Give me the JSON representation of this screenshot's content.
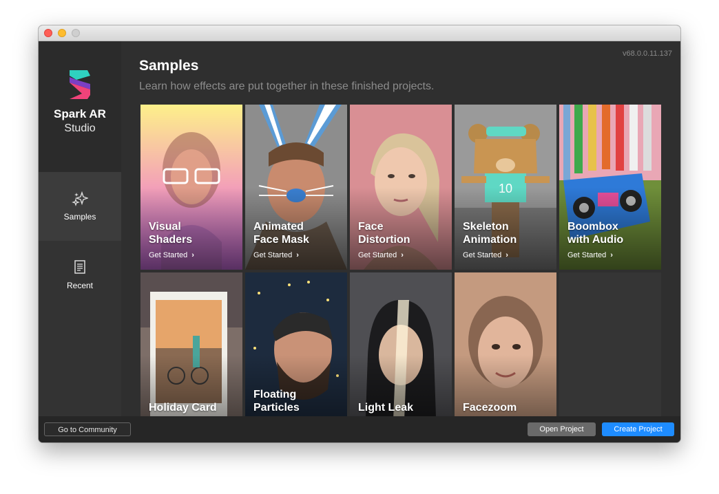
{
  "app": {
    "name": "Spark AR",
    "name_sub": "Studio",
    "version": "v68.0.0.11.137"
  },
  "sidebar": {
    "items": [
      {
        "label": "Samples",
        "icon": "sparkle-icon",
        "active": true
      },
      {
        "label": "Recent",
        "icon": "document-icon",
        "active": false
      }
    ]
  },
  "main": {
    "heading": "Samples",
    "subheading": "Learn how effects are put together in these finished projects."
  },
  "cards": [
    {
      "title_l1": "Visual",
      "title_l2": "Shaders",
      "cta": "Get Started"
    },
    {
      "title_l1": "Animated",
      "title_l2": "Face Mask",
      "cta": "Get Started"
    },
    {
      "title_l1": "Face",
      "title_l2": "Distortion",
      "cta": "Get Started"
    },
    {
      "title_l1": "Skeleton",
      "title_l2": "Animation",
      "cta": "Get Started"
    },
    {
      "title_l1": "Boombox",
      "title_l2": "with Audio",
      "cta": "Get Started"
    },
    {
      "title_l1": "",
      "title_l2": "Holiday Card"
    },
    {
      "title_l1": "Floating",
      "title_l2": "Particles"
    },
    {
      "title_l1": "",
      "title_l2": "Light Leak"
    },
    {
      "title_l1": "",
      "title_l2": "Facezoom"
    }
  ],
  "footer": {
    "community": "Go to Community",
    "open": "Open Project",
    "create": "Create Project"
  },
  "colors": {
    "accent": "#1e8cff",
    "logo_teal": "#2fd1c0",
    "logo_pink": "#f0437a"
  }
}
